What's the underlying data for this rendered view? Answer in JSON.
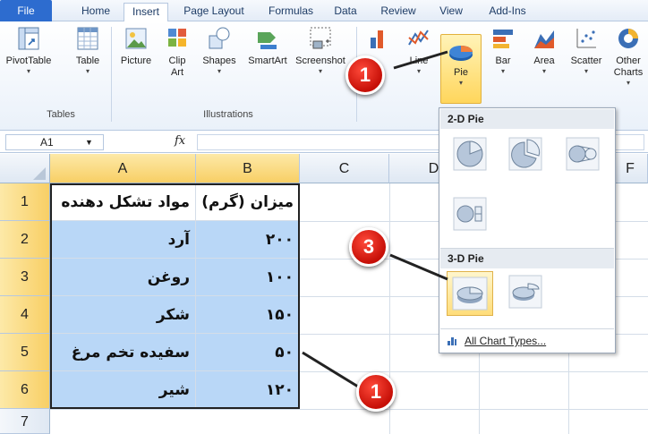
{
  "ribbon_tabs": [
    "File",
    "Home",
    "Insert",
    "Page Layout",
    "Formulas",
    "Data",
    "Review",
    "View",
    "Add-Ins"
  ],
  "ribbon": {
    "pivottable": "PivotTable",
    "table": "Table",
    "tables_group": "Tables",
    "picture": "Picture",
    "clipart": "Clip Art",
    "shapes": "Shapes",
    "smartart": "SmartArt",
    "screenshot": "Screenshot",
    "illustrations_group": "Illustrations",
    "line": "Line",
    "pie": "Pie",
    "bar": "Bar",
    "area": "Area",
    "scatter": "Scatter",
    "other_charts": "Other Charts"
  },
  "formula_bar": {
    "name_box": "A1",
    "fx": "fx"
  },
  "columns": [
    "A",
    "B",
    "C",
    "D",
    "E",
    "F"
  ],
  "rows": [
    "1",
    "2",
    "3",
    "4",
    "5",
    "6",
    "7"
  ],
  "table": {
    "header": {
      "a": "مواد تشکل دهنده",
      "b": "میزان (گرم)"
    },
    "data": [
      {
        "a": "آرد",
        "b": "۲۰۰"
      },
      {
        "a": "روغن",
        "b": "۱۰۰"
      },
      {
        "a": "شکر",
        "b": "۱۵۰"
      },
      {
        "a": "سفیده تخم مرغ",
        "b": "۵۰"
      },
      {
        "a": "شیر",
        "b": "۱۲۰"
      }
    ]
  },
  "pie_menu": {
    "section_2d": "2-D Pie",
    "section_3d": "3-D Pie",
    "all_chart_types": "All Chart Types..."
  },
  "callouts": {
    "one": "1",
    "three": "3",
    "one_b": "1"
  },
  "colors": {
    "selection": "#b9d7f7",
    "callout": "#d9160c",
    "file_tab": "#2d6ccf",
    "highlight": "#ffd65c"
  }
}
